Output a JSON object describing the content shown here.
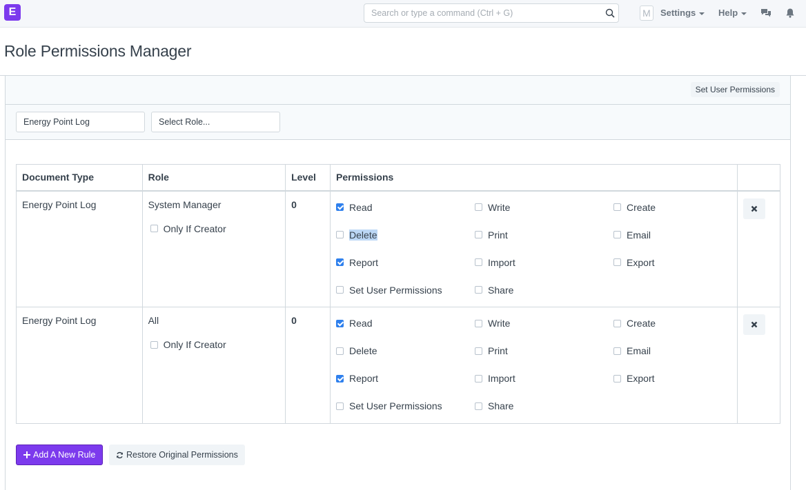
{
  "navbar": {
    "logo_letter": "E",
    "search_placeholder": "Search or type a command (Ctrl + G)",
    "avatar_letter": "M",
    "settings_label": "Settings",
    "help_label": "Help"
  },
  "page": {
    "title": "Role Permissions Manager",
    "set_user_permissions_label": "Set User Permissions"
  },
  "filters": {
    "doctype_value": "Energy Point Log",
    "role_placeholder": "Select Role..."
  },
  "table": {
    "headers": [
      "Document Type",
      "Role",
      "Level",
      "Permissions",
      ""
    ],
    "rows": [
      {
        "document_type": "Energy Point Log",
        "role": "System Manager",
        "only_if_creator_label": "Only If Creator",
        "only_if_creator": false,
        "level": "0",
        "permissions": [
          {
            "label": "Read",
            "checked": true
          },
          {
            "label": "Write",
            "checked": false
          },
          {
            "label": "Create",
            "checked": false
          },
          {
            "label": "Delete",
            "checked": false,
            "highlighted": true
          },
          {
            "label": "Print",
            "checked": false
          },
          {
            "label": "Email",
            "checked": false
          },
          {
            "label": "Report",
            "checked": true
          },
          {
            "label": "Import",
            "checked": false
          },
          {
            "label": "Export",
            "checked": false
          },
          {
            "label": "Set User Permissions",
            "checked": false
          },
          {
            "label": "Share",
            "checked": false
          }
        ]
      },
      {
        "document_type": "Energy Point Log",
        "role": "All",
        "only_if_creator_label": "Only If Creator",
        "only_if_creator": false,
        "level": "0",
        "permissions": [
          {
            "label": "Read",
            "checked": true
          },
          {
            "label": "Write",
            "checked": false
          },
          {
            "label": "Create",
            "checked": false
          },
          {
            "label": "Delete",
            "checked": false
          },
          {
            "label": "Print",
            "checked": false
          },
          {
            "label": "Email",
            "checked": false
          },
          {
            "label": "Report",
            "checked": true
          },
          {
            "label": "Import",
            "checked": false
          },
          {
            "label": "Export",
            "checked": false
          },
          {
            "label": "Set User Permissions",
            "checked": false
          },
          {
            "label": "Share",
            "checked": false
          }
        ]
      }
    ]
  },
  "footer": {
    "add_rule_label": "Add A New Rule",
    "restore_label": "Restore Original Permissions"
  },
  "colors": {
    "primary": "#7c3aed",
    "checkbox_checked": "#2f80ed",
    "highlight": "#bcd7f5"
  }
}
